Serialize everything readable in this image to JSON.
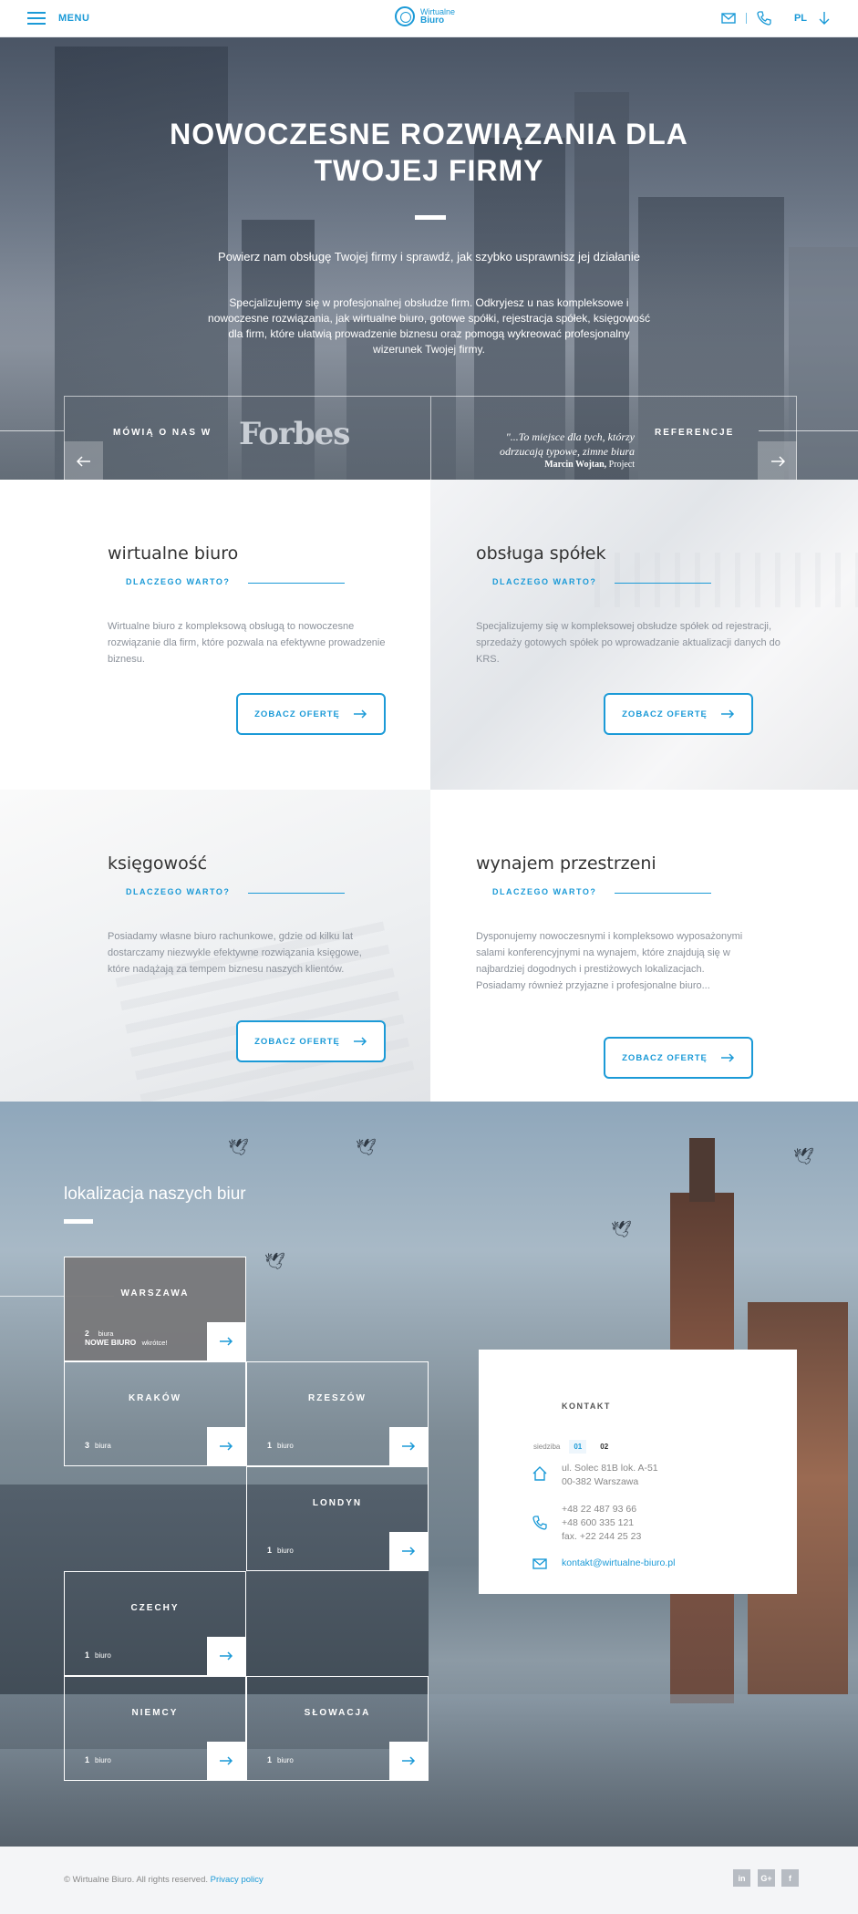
{
  "header": {
    "menu_label": "MENU",
    "logo_line1": "Wirtualne",
    "logo_line2": "Biuro",
    "lang": "PL"
  },
  "hero": {
    "title_line1": "NOWOCZESNE ROZWIĄZANIA DLA",
    "title_line2": "TWOJEJ FIRMY",
    "lead": "Powierz nam obsługę Twojej firmy i sprawdź, jak szybko usprawnisz jej działanie",
    "description": "Specjalizujemy się w profesjonalnej obsłudze firm. Odkryjesz u nas kompleksowe i nowoczesne rozwiązania, jak wirtualne biuro, gotowe spółki, rejestracja spółek, księgowość dla firm, które ułatwią prowadzenie biznesu oraz pomogą wykreować profesjonalny wizerunek Twojej firmy.",
    "press_label": "MÓWIĄ O NAS W",
    "press_name": "Forbes",
    "quote_line1": "\"...To miejsce dla tych, którzy",
    "quote_line2": "odrzucają typowe, zimne biura",
    "quote_author": "Marcin Wojtan,",
    "quote_company": "Project",
    "references_label": "REFERENCJE"
  },
  "services": [
    {
      "title": "wirtualne biuro",
      "why": "DLACZEGO WARTO?",
      "text": "Wirtualne biuro z kompleksową obsługą to nowoczesne rozwiązanie dla firm, które pozwala na efektywne prowadzenie biznesu.",
      "button": "ZOBACZ OFERTĘ"
    },
    {
      "title": "obsługa spółek",
      "why": "DLACZEGO WARTO?",
      "text": "Specjalizujemy się w kompleksowej obsłudze spółek od rejestracji, sprzedaży gotowych spółek po wprowadzanie aktualizacji danych do KRS.",
      "button": "ZOBACZ OFERTĘ"
    },
    {
      "title": "księgowość",
      "why": "DLACZEGO WARTO?",
      "text": "Posiadamy własne biuro rachunkowe, gdzie od kilku lat dostarczamy niezwykle efektywne rozwiązania księgowe, które nadążają za tempem biznesu naszych klientów.",
      "button": "ZOBACZ OFERTĘ"
    },
    {
      "title": "wynajem przestrzeni",
      "why": "DLACZEGO WARTO?",
      "text": "Dysponujemy nowoczesnymi i kompleksowo wyposażonymi salami konferencyjnymi na wynajem, które znajdują się w najbardziej dogodnych i prestiżowych lokalizacjach. Posiadamy również przyjazne i profesjonalne biuro...",
      "button": "ZOBACZ OFERTĘ"
    }
  ],
  "locations": {
    "title": "lokalizacja naszych biur",
    "items": [
      {
        "name": "WARSZAWA",
        "count": "2",
        "unit": "biura",
        "new_label": "NOWE BIURO",
        "soon": "wkrótce!"
      },
      {
        "name": "KRAKÓW",
        "count": "3",
        "unit": "biura"
      },
      {
        "name": "RZESZÓW",
        "count": "1",
        "unit": "biuro"
      },
      {
        "name": "LONDYN",
        "count": "1",
        "unit": "biuro"
      },
      {
        "name": "CZECHY",
        "count": "1",
        "unit": "biuro"
      },
      {
        "name": "NIEMCY",
        "count": "1",
        "unit": "biuro"
      },
      {
        "name": "SŁOWACJA",
        "count": "1",
        "unit": "biuro"
      }
    ]
  },
  "contact": {
    "title": "KONTAKT",
    "seat_label": "siedziba",
    "tabs": [
      "01",
      "02"
    ],
    "address_line1": "ul. Solec 81B lok. A-51",
    "address_line2": "00-382 Warszawa",
    "phone1": "+48 22 487 93 66",
    "phone2": "+48 600 335 121",
    "fax": "fax. +22 244 25 23",
    "email": "kontakt@wirtualne-biuro.pl"
  },
  "footer": {
    "copyright": "© Wirtualne Biuro. All rights reserved.",
    "privacy": "Privacy policy",
    "social": [
      "in",
      "G+",
      "f"
    ]
  },
  "colors": {
    "accent": "#1b9ad7",
    "footer_bg": "#f4f5f7",
    "active_cell": "#78787a"
  }
}
